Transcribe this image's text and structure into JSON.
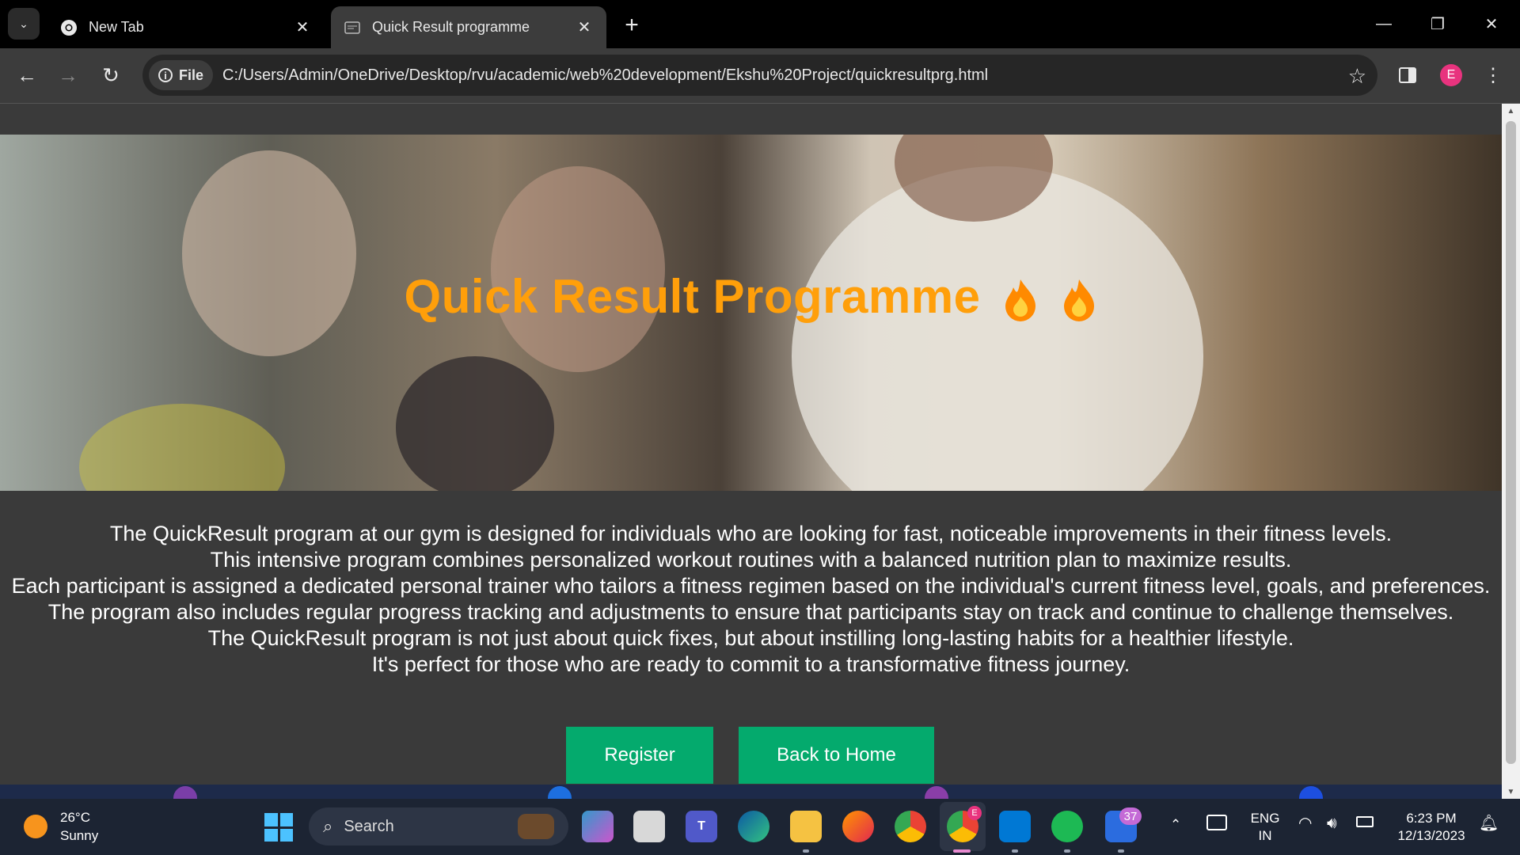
{
  "browser": {
    "tabs": [
      {
        "label": "New Tab",
        "active": false
      },
      {
        "label": "Quick Result programme",
        "active": true
      }
    ],
    "address": {
      "scheme_chip": "File",
      "url": "C:/Users/Admin/OneDrive/Desktop/rvu/academic/web%20development/Ekshu%20Project/quickresultprg.html"
    },
    "profile_initial": "E"
  },
  "page": {
    "hero_title": "Quick Result Programme",
    "hero_emoji": "fire-icon",
    "accent_color": "#ff9f0a",
    "paragraphs": [
      "The QuickResult program at our gym is designed for individuals who are looking for fast, noticeable improvements in their fitness levels.",
      "This intensive program combines personalized workout routines with a balanced nutrition plan to maximize results.",
      "Each participant is assigned a dedicated personal trainer who tailors a fitness regimen based on the individual's current fitness level, goals, and preferences.",
      "The program also includes regular progress tracking and adjustments to ensure that participants stay on track and continue to challenge themselves.",
      "The QuickResult program is not just about quick fixes, but about instilling long-lasting habits for a healthier lifestyle.",
      "It's perfect for those who are ready to commit to a transformative fitness journey."
    ],
    "buttons": {
      "register": "Register",
      "back_home": "Back to Home"
    },
    "button_color": "#04aa6d"
  },
  "taskbar": {
    "weather_temp": "26°C",
    "weather_desc": "Sunny",
    "search_placeholder": "Search",
    "teams_badge": "37",
    "chrome_badge": "E",
    "language": "ENG",
    "region": "IN",
    "time": "6:23 PM",
    "date": "12/13/2023"
  }
}
